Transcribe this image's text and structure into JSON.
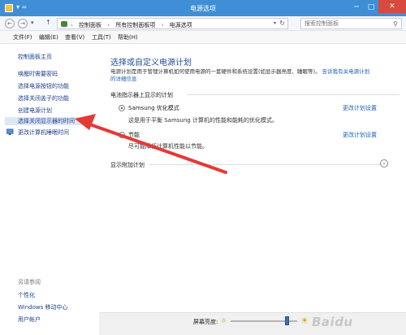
{
  "window": {
    "title": "电源选项",
    "minimize": "─",
    "maximize": "□",
    "close": "✕",
    "quick_access": "▾ ="
  },
  "nav": {
    "back": "←",
    "forward": "→",
    "history": "▾",
    "up": "↑",
    "breadcrumb": [
      "控制面板",
      "所有控制面板项",
      "电源选项"
    ],
    "separator": "›",
    "dropdown": "▾",
    "refresh": "↻",
    "search_placeholder": "搜索控制面板",
    "search_icon": "⚲"
  },
  "menu": {
    "items": [
      "文件(F)",
      "编辑(E)",
      "查看(V)",
      "工具(T)",
      "帮助(H)"
    ]
  },
  "sidebar": {
    "home": "控制面板主页",
    "links": [
      "唤醒时需要密码",
      "选择电源按钮的功能",
      "选择关闭盖子的功能",
      "创建电源计划",
      "选择关闭显示器的时间",
      "更改计算机睡眠时间"
    ],
    "see_also_title": "另请参阅",
    "see_also": [
      "个性化",
      "Windows 移动中心",
      "用户帐户"
    ]
  },
  "main": {
    "title": "选择或自定义电源计划",
    "desc_line1": "电源计划是用于管理计算机如何使用电源的一套硬件和系统设置(如显示器亮度、睡眠等)。",
    "desc_link1": "告诉我有关电源计划",
    "desc_link2": "的详细信息",
    "section_label": "电池指示器上显示的计划",
    "plans": [
      {
        "name": "Samsung 优化模式",
        "desc": "这是用于平衡 Samsung 计算机的性能和能耗的优化模式。",
        "link": "更改计划设置",
        "selected": true
      },
      {
        "name": "节能",
        "desc": "尽可能降低计算机性能以节能。",
        "link": "更改计划设置",
        "selected": false
      }
    ],
    "show_more": "显示附加计划",
    "expand_icon": "⌄"
  },
  "bottom": {
    "brightness_label": "屏幕亮度:",
    "brightness_level": 0.85,
    "sun_small": "☼",
    "sun_big": "☀",
    "watermark": "Baidu"
  },
  "colors": {
    "titlebar": "#3f8ed6",
    "link": "#1e5fb6",
    "heading": "#1e4d9c",
    "annotation_arrow": "#e53935"
  }
}
